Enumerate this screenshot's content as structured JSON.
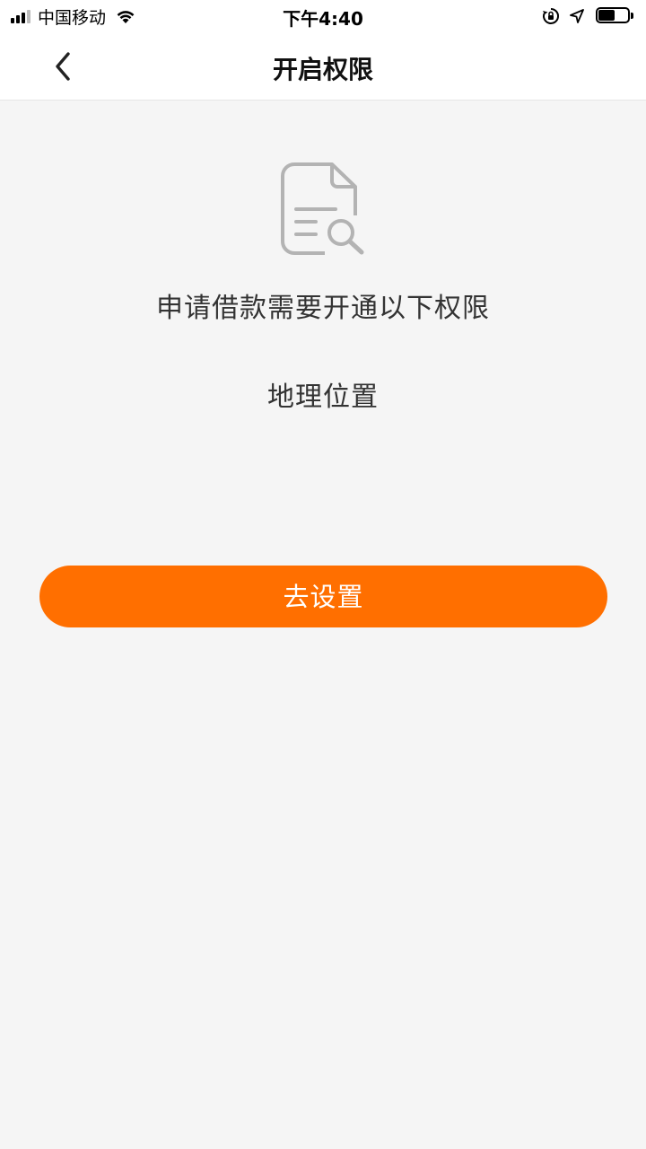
{
  "status_bar": {
    "carrier": "中国移动",
    "time": "下午4:40",
    "icons": [
      "signal-icon",
      "wifi-icon",
      "orientation-lock-icon",
      "location-arrow-icon",
      "battery-icon"
    ]
  },
  "nav": {
    "title": "开启权限",
    "back_icon": "chevron-left-icon"
  },
  "content": {
    "icon": "document-search-icon",
    "message": "申请借款需要开通以下权限",
    "permissions": [
      "地理位置"
    ]
  },
  "actions": {
    "settings_label": "去设置"
  },
  "colors": {
    "accent": "#ff6f00",
    "background": "#f5f5f5",
    "icon_gray": "#b3b3b3",
    "text": "#333333"
  }
}
